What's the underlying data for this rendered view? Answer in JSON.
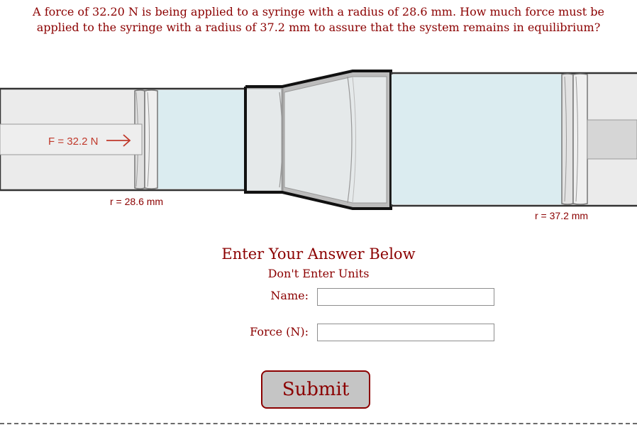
{
  "question": "A force of 32.20 N is being applied to a syringe with a radius of 28.6 mm. How much force must be applied to the syringe with a radius of 37.2 mm to assure that the system remains in equilibrium?",
  "diagram": {
    "force_label": "F = 32.2 N",
    "left_radius_label": "r = 28.6 mm",
    "right_radius_label": "r = 37.2 mm",
    "icons": [
      "arrow-right-icon"
    ],
    "colors": {
      "fluid": "#dbecf0",
      "tube": "#ebebeb",
      "label": "#c0392b",
      "radius_text": "#8b0000"
    }
  },
  "form": {
    "title": "Enter Your Answer Below",
    "subtitle": "Don't Enter Units",
    "name_label": "Name:",
    "name_value": "",
    "force_label": "Force (N):",
    "force_value": "",
    "submit_label": "Submit"
  },
  "colors": {
    "text": "#8b0000",
    "button_bg": "#c5c5c5"
  }
}
